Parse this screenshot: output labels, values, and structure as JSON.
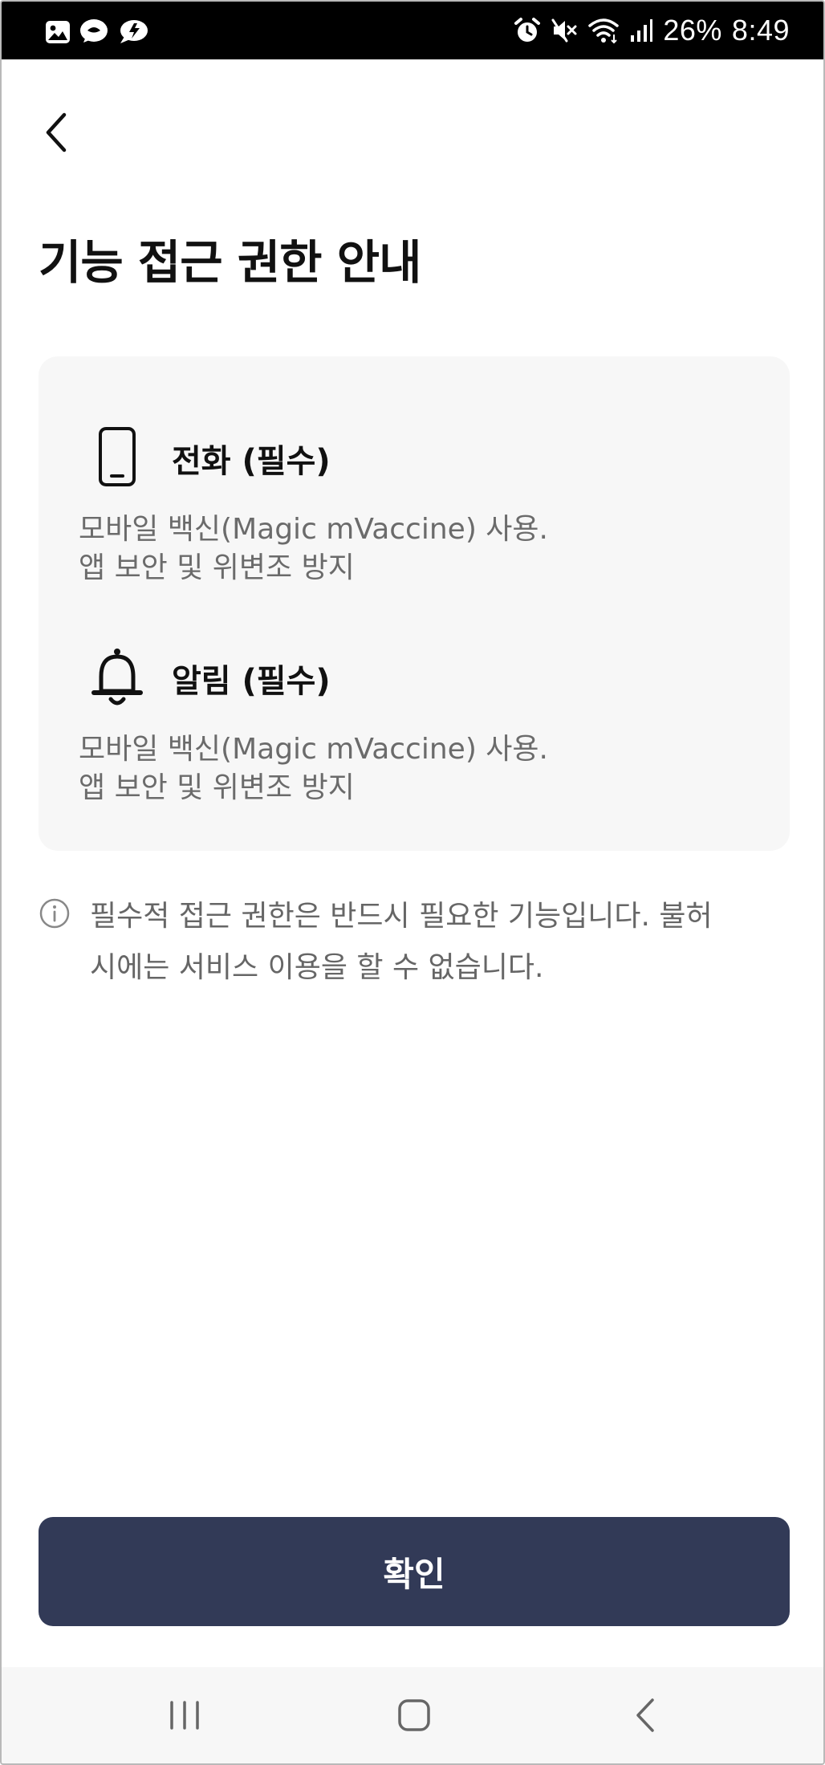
{
  "status_bar": {
    "battery": "26%",
    "time": "8:49",
    "icons_left": [
      "gallery-icon",
      "talk-icon",
      "message-icon"
    ],
    "icons_right": [
      "alarm-icon",
      "mute-icon",
      "wifi-icon",
      "signal-icon"
    ]
  },
  "header": {
    "back_icon": "chevron-left-icon",
    "title": "기능 접근 권한 안내"
  },
  "permissions": [
    {
      "icon": "phone-icon",
      "title": "전화 (필수)",
      "desc_line1": "모바일 백신(Magic mVaccine) 사용.",
      "desc_line2": "앱 보안 및 위변조 방지"
    },
    {
      "icon": "bell-icon",
      "title": "알림 (필수)",
      "desc_line1": "모바일 백신(Magic mVaccine) 사용.",
      "desc_line2": "앱 보안 및 위변조 방지"
    }
  ],
  "notice": {
    "icon": "info-icon",
    "line1": "필수적 접근 권한은 반드시 필요한 기능입니다. 불허",
    "line2": "시에는 서비스 이용을 할 수 없습니다."
  },
  "confirm_label": "확인",
  "nav_bar": {
    "icons": [
      "recent-apps-icon",
      "home-icon",
      "back-icon"
    ]
  },
  "colors": {
    "button_bg": "#323a57",
    "card_bg": "#f7f7f7",
    "status_bar_bg": "#000000"
  }
}
